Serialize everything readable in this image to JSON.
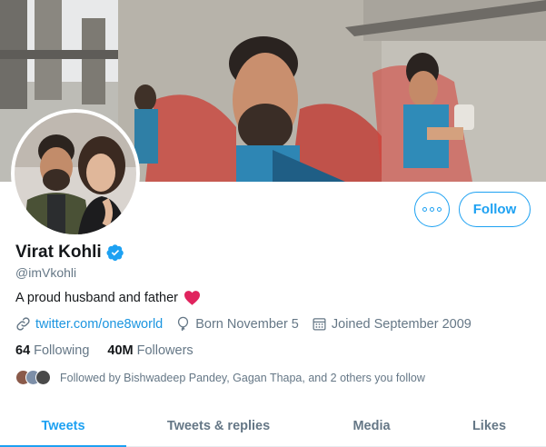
{
  "profile": {
    "name": "Virat Kohli",
    "handle": "@imVkohli",
    "bio": "A proud husband and father",
    "link": "twitter.com/one8world",
    "born": "Born November 5",
    "joined": "Joined September 2009",
    "following_count": "64",
    "following_label": "Following",
    "followers_count": "40M",
    "followers_label": "Followers",
    "followed_by": "Followed by Bishwadeep Pandey, Gagan Thapa, and 2 others you follow"
  },
  "actions": {
    "follow_label": "Follow"
  },
  "tabs": [
    {
      "label": "Tweets",
      "active": true
    },
    {
      "label": "Tweets & replies",
      "active": false
    },
    {
      "label": "Media",
      "active": false
    },
    {
      "label": "Likes",
      "active": false
    }
  ],
  "icons": {
    "verified": "verified-badge-icon",
    "heart": "red-heart-icon",
    "link": "link-icon",
    "born": "balloon-icon",
    "joined": "calendar-icon",
    "more": "more-dots-icon"
  },
  "colors": {
    "accent": "#1da1f2",
    "secondary_text": "#657786",
    "primary_text": "#14171a",
    "heart": "#e0245e"
  }
}
